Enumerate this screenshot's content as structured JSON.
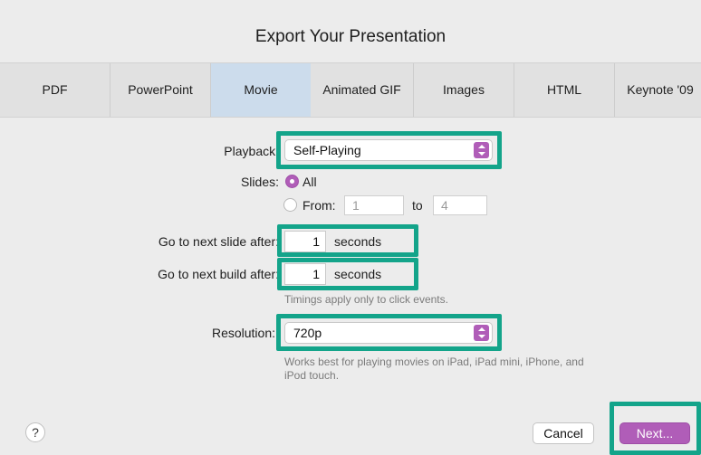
{
  "dialog": {
    "title": "Export Your Presentation"
  },
  "tabs": [
    {
      "label": "PDF"
    },
    {
      "label": "PowerPoint"
    },
    {
      "label": "Movie"
    },
    {
      "label": "Animated GIF"
    },
    {
      "label": "Images"
    },
    {
      "label": "HTML"
    },
    {
      "label": "Keynote '09"
    }
  ],
  "active_tab": "Movie",
  "playback": {
    "label": "Playback:",
    "value": "Self-Playing",
    "icon": "chevron-updown-icon"
  },
  "slides": {
    "label": "Slides:",
    "all_label": "All",
    "from_label": "From:",
    "from_value": "1",
    "to_label": "to",
    "to_value": "4",
    "selected": "All"
  },
  "next_slide": {
    "label": "Go to next slide after:",
    "value": "1",
    "unit": "seconds"
  },
  "next_build": {
    "label": "Go to next build after:",
    "value": "1",
    "unit": "seconds"
  },
  "timings_hint": "Timings apply only to click events.",
  "resolution": {
    "label": "Resolution:",
    "value": "720p",
    "icon": "chevron-updown-icon"
  },
  "resolution_hint_line1": "Works best for playing movies on iPad, iPad mini, iPhone, and",
  "resolution_hint_line2": "iPod touch.",
  "footer": {
    "help_label": "?",
    "cancel_label": "Cancel",
    "next_label": "Next..."
  },
  "colors": {
    "highlight": "#13a48a",
    "accent": "#b05db8",
    "active_tab": "#ccdcec"
  }
}
